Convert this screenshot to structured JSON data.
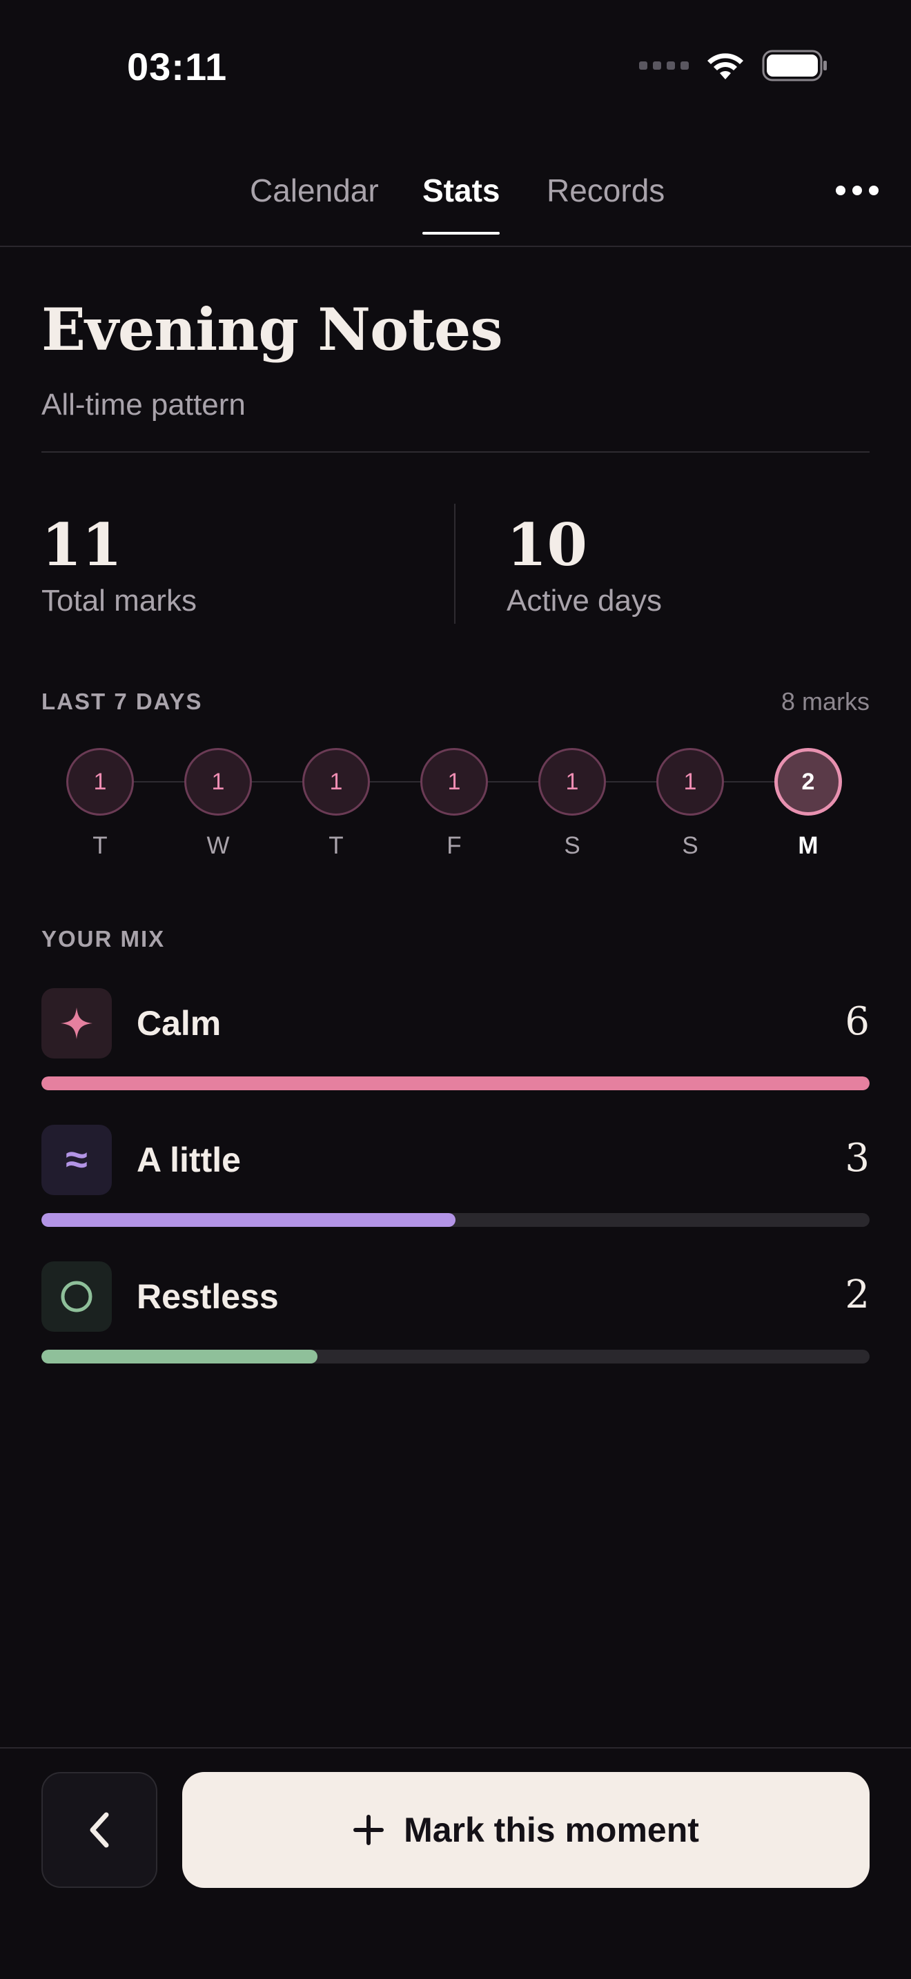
{
  "status_bar": {
    "time": "03:11"
  },
  "tabs": [
    {
      "label": "Calendar"
    },
    {
      "label": "Stats"
    },
    {
      "label": "Records"
    }
  ],
  "header": {
    "title": "Evening Notes",
    "subtitle": "All-time pattern"
  },
  "totals": {
    "total_value": "11",
    "total_label": "Total marks",
    "active_value": "10",
    "active_label": "Active days"
  },
  "last7": {
    "heading": "LAST 7 DAYS",
    "summary": "8 marks",
    "days": [
      {
        "label": "T",
        "count": "1"
      },
      {
        "label": "W",
        "count": "1"
      },
      {
        "label": "T",
        "count": "1"
      },
      {
        "label": "F",
        "count": "1"
      },
      {
        "label": "S",
        "count": "1"
      },
      {
        "label": "S",
        "count": "1"
      },
      {
        "label": "M",
        "count": "2"
      }
    ]
  },
  "mix": {
    "heading": "YOUR MIX",
    "items": [
      {
        "label": "Calm",
        "count": "6",
        "fraction": 1.0,
        "color": "#e5809f",
        "icon": "sparkle-icon",
        "glyph": "✦"
      },
      {
        "label": "A little",
        "count": "3",
        "fraction": 0.5,
        "color": "#b394e6",
        "icon": "wave-icon",
        "glyph": "≈"
      },
      {
        "label": "Restless",
        "count": "2",
        "fraction": 0.333,
        "color": "#8fc09a",
        "icon": "circle-icon",
        "glyph": ""
      }
    ]
  },
  "footer": {
    "primary_label": "Mark this moment"
  }
}
